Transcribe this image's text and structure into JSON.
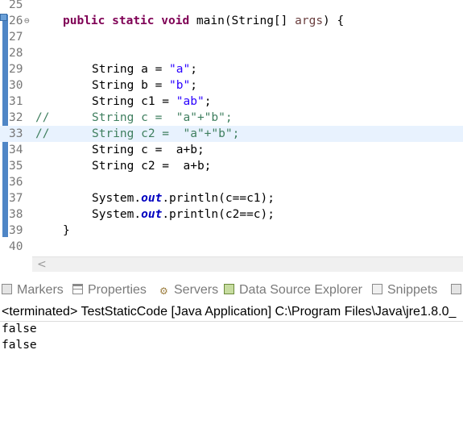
{
  "editor": {
    "lines": [
      {
        "n": "25"
      },
      {
        "n": "26",
        "fold": "⊖"
      },
      {
        "n": "27"
      },
      {
        "n": "28"
      },
      {
        "n": "29"
      },
      {
        "n": "30"
      },
      {
        "n": "31"
      },
      {
        "n": "32",
        "comment": "//"
      },
      {
        "n": "33",
        "comment": "//"
      },
      {
        "n": "34"
      },
      {
        "n": "35"
      },
      {
        "n": "36"
      },
      {
        "n": "37"
      },
      {
        "n": "38"
      },
      {
        "n": "39"
      },
      {
        "n": "40"
      }
    ],
    "l26": {
      "kw1": "public",
      "kw2": "static",
      "kw3": "void",
      "name": " main(String[] ",
      "param": "args",
      "tail": ") {"
    },
    "l29": {
      "pre": "String a = ",
      "str": "\"a\"",
      "post": ";"
    },
    "l30": {
      "pre": "String b = ",
      "str": "\"b\"",
      "post": ";"
    },
    "l31": {
      "pre": "String c1 = ",
      "str": "\"ab\"",
      "post": ";"
    },
    "l32": {
      "text": "String c =  \"a\"+\"b\";"
    },
    "l33": {
      "text": "String c2 =  \"a\"+\"b\";"
    },
    "l34": {
      "text": "String c =  a+b;"
    },
    "l35": {
      "text": "String c2 =  a+b;"
    },
    "l37": {
      "pre": "System.",
      "fld": "out",
      "post": ".println(c==c1);"
    },
    "l38": {
      "pre": "System.",
      "fld": "out",
      "post": ".println(c2==c);"
    },
    "l39": {
      "text": "}"
    },
    "scroll_arrow": "<"
  },
  "tabs": [
    {
      "label": "Markers",
      "icon": "markers-icon"
    },
    {
      "label": "Properties",
      "icon": "properties-icon"
    },
    {
      "label": "Servers",
      "icon": "servers-icon"
    },
    {
      "label": "Data Source Explorer",
      "icon": "data-source-icon"
    },
    {
      "label": "Snippets",
      "icon": "snippets-icon"
    }
  ],
  "console": {
    "header": "<terminated> TestStaticCode [Java Application] C:\\Program Files\\Java\\jre1.8.0_",
    "output": [
      "false",
      "false"
    ]
  },
  "colors": {
    "keyword": "#7f0055",
    "string": "#2a00ff",
    "comment": "#3f7f5f",
    "highlight": "#e8f2fe"
  }
}
